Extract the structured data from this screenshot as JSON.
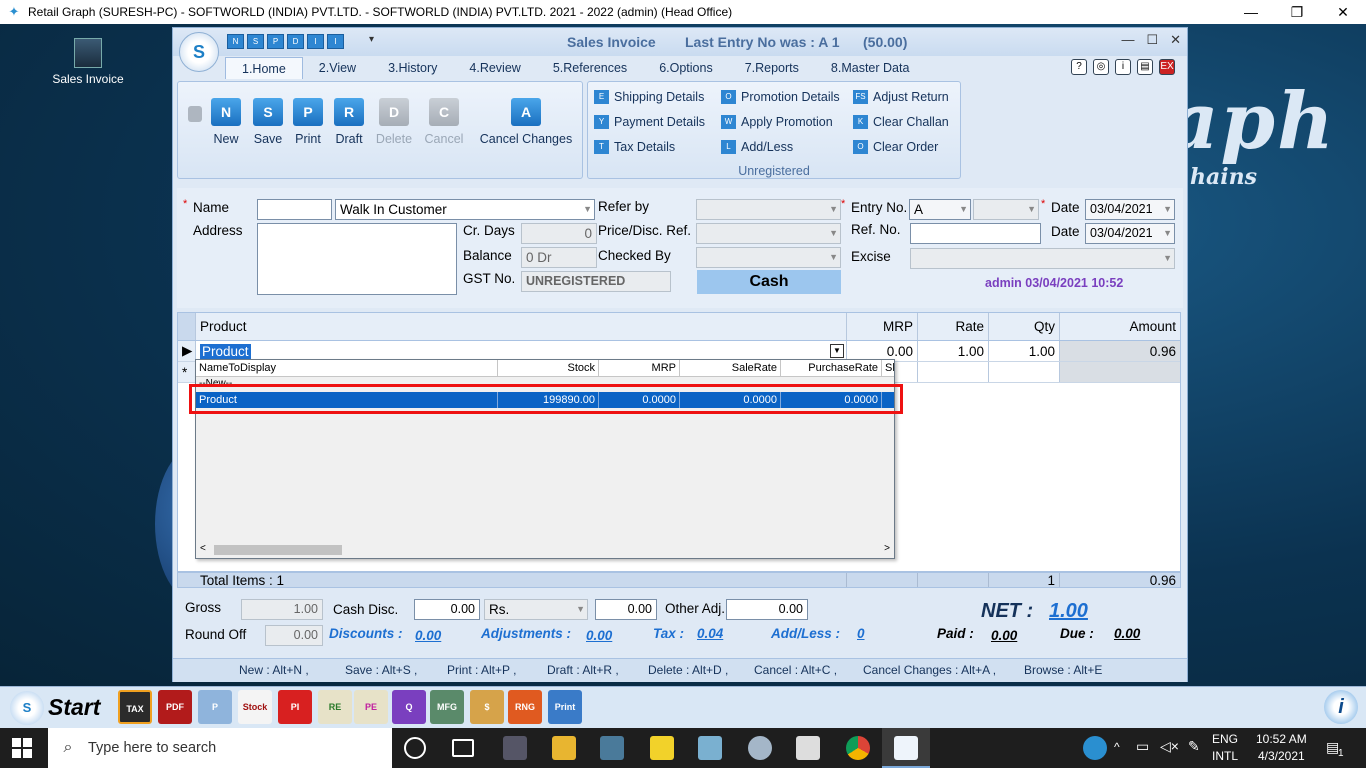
{
  "app_window": {
    "title": "Retail Graph (SURESH-PC) - SOFTWORLD (INDIA) PVT.LTD. - SOFTWORLD (INDIA) PVT.LTD.  2021 - 2022 (admin) (Head Office)",
    "minimize": "—",
    "maximize": "❐",
    "close": "✕"
  },
  "desktop": {
    "shortcut_label": "Sales Invoice",
    "logo_text": "aph",
    "logo_sub": "hains"
  },
  "invoice": {
    "caption": "Sales Invoice",
    "last_entry": "Last Entry No was : A 1",
    "last_amount": "(50.00)",
    "win_min": "—",
    "win_max": "☐",
    "win_close": "✕",
    "quick_access": [
      "N",
      "S",
      "P",
      "D",
      "I",
      "I"
    ],
    "tabs": [
      "1.Home",
      "2.View",
      "3.History",
      "4.Review",
      "5.References",
      "6.Options",
      "7.Reports",
      "8.Master Data"
    ],
    "active_tab": "1.Home"
  },
  "ribbon": {
    "buttons": [
      {
        "label": "New",
        "glyph": "N",
        "enabled": true
      },
      {
        "label": "Save",
        "glyph": "S",
        "enabled": true
      },
      {
        "label": "Print",
        "glyph": "P",
        "enabled": true
      },
      {
        "label": "Draft",
        "glyph": "R",
        "enabled": true
      },
      {
        "label": "Delete",
        "glyph": "D",
        "enabled": false
      },
      {
        "label": "Cancel",
        "glyph": "C",
        "enabled": false
      },
      {
        "label": "Cancel Changes",
        "glyph": "A",
        "enabled": true
      }
    ],
    "links": [
      {
        "label": "Shipping Details",
        "glyph": "E"
      },
      {
        "label": "Payment Details",
        "glyph": "Y"
      },
      {
        "label": "Tax Details",
        "glyph": "T"
      },
      {
        "label": "Promotion Details",
        "glyph": "O"
      },
      {
        "label": "Apply Promotion",
        "glyph": "W"
      },
      {
        "label": "Add/Less",
        "glyph": "L"
      },
      {
        "label": "Adjust Return",
        "glyph": "FS"
      },
      {
        "label": "Clear Challan",
        "glyph": "K"
      },
      {
        "label": "Clear Order",
        "glyph": "O"
      }
    ],
    "status_label": "Unregistered"
  },
  "form": {
    "name_label": "Name",
    "name_code": "",
    "customer": "Walk In Customer",
    "address_label": "Address",
    "cr_days_label": "Cr. Days",
    "cr_days": "0",
    "balance_label": "Balance",
    "balance": "0 Dr",
    "gst_label": "GST No.",
    "gst": "UNREGISTERED",
    "refer_by_label": "Refer by",
    "price_disc_label": "Price/Disc. Ref.",
    "checked_by_label": "Checked By",
    "cash_label": "Cash",
    "entry_no_label": "Entry No.",
    "entry_series": "A",
    "ref_no_label": "Ref. No.",
    "excise_label": "Excise",
    "date_label": "Date",
    "date1": "03/04/2021",
    "date2": "03/04/2021",
    "admin_stamp": "admin 03/04/2021 10:52"
  },
  "grid": {
    "headers": {
      "product": "Product",
      "mrp": "MRP",
      "rate": "Rate",
      "qty": "Qty",
      "amount": "Amount"
    },
    "row": {
      "product": "Product",
      "mrp": "0.00",
      "rate": "1.00",
      "qty": "1.00",
      "amount": "0.96"
    },
    "new_row_marker": "*",
    "footer": {
      "total_items": "Total Items : 1",
      "qty": "1",
      "amount": "0.96"
    }
  },
  "dropdown": {
    "headers": [
      "NameToDisplay",
      "Stock",
      "MRP",
      "SaleRate",
      "PurchaseRate",
      "Sh"
    ],
    "new_item": "--New--",
    "selected_row": {
      "name": "Product",
      "stock": "199890.00",
      "mrp": "0.0000",
      "sale_rate": "0.0000",
      "purchase_rate": "0.0000"
    }
  },
  "totals": {
    "gross_label": "Gross",
    "gross": "1.00",
    "cash_disc_label": "Cash Disc.",
    "cash_disc": "0.00",
    "currency": "Rs.",
    "cash_disc_amt": "0.00",
    "other_adj_label": "Other Adj.",
    "other_adj": "0.00",
    "net_label": "NET :",
    "net": "1.00",
    "round_off_label": "Round Off",
    "round_off": "0.00",
    "discounts_label": "Discounts :",
    "discounts": "0.00",
    "adjustments_label": "Adjustments :",
    "adjustments": "0.00",
    "tax_label": "Tax :",
    "tax": "0.04",
    "addless_label": "Add/Less :",
    "addless": "0",
    "paid_label": "Paid :",
    "paid": "0.00",
    "due_label": "Due :",
    "due": "0.00"
  },
  "shortcuts": [
    "New : Alt+N ,",
    "Save : Alt+S ,",
    "Print : Alt+P ,",
    "Draft : Alt+R ,",
    "Delete : Alt+D ,",
    "Cancel : Alt+C ,",
    "Cancel Changes : Alt+A ,",
    "Browse : Alt+E"
  ],
  "app_toolbar": {
    "start_label": "Start",
    "icons": [
      "TAX",
      "PDF",
      "P",
      "Stock",
      "PI",
      "RE",
      "PE",
      "Q",
      "MFG",
      "$",
      "RNG",
      "Print"
    ]
  },
  "taskbar": {
    "search_placeholder": "Type here to search",
    "lang1": "ENG",
    "lang2": "INTL",
    "time": "10:52 AM",
    "date": "4/3/2021",
    "notifications": "1"
  },
  "colors": {
    "accent": "#1d6fd1",
    "highlight_box": "#e11111",
    "admin_stamp": "#7a3fbf"
  }
}
